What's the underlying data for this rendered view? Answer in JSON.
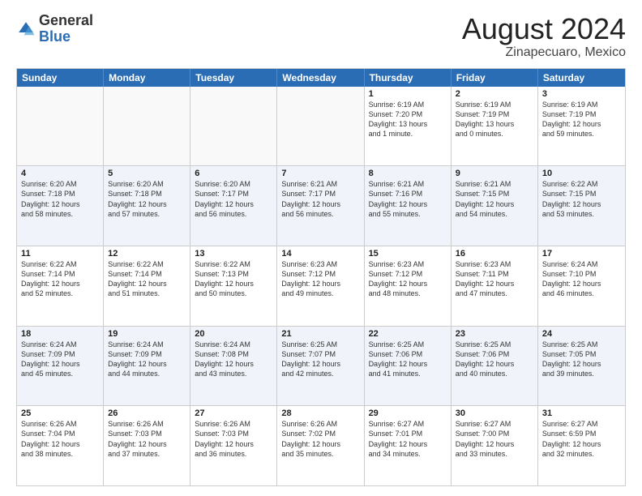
{
  "header": {
    "logo": {
      "general": "General",
      "blue": "Blue"
    },
    "month_year": "August 2024",
    "location": "Zinapecuaro, Mexico"
  },
  "days_of_week": [
    "Sunday",
    "Monday",
    "Tuesday",
    "Wednesday",
    "Thursday",
    "Friday",
    "Saturday"
  ],
  "rows": [
    {
      "alt": false,
      "cells": [
        {
          "day": "",
          "text": ""
        },
        {
          "day": "",
          "text": ""
        },
        {
          "day": "",
          "text": ""
        },
        {
          "day": "",
          "text": ""
        },
        {
          "day": "1",
          "text": "Sunrise: 6:19 AM\nSunset: 7:20 PM\nDaylight: 13 hours\nand 1 minute."
        },
        {
          "day": "2",
          "text": "Sunrise: 6:19 AM\nSunset: 7:19 PM\nDaylight: 13 hours\nand 0 minutes."
        },
        {
          "day": "3",
          "text": "Sunrise: 6:19 AM\nSunset: 7:19 PM\nDaylight: 12 hours\nand 59 minutes."
        }
      ]
    },
    {
      "alt": true,
      "cells": [
        {
          "day": "4",
          "text": "Sunrise: 6:20 AM\nSunset: 7:18 PM\nDaylight: 12 hours\nand 58 minutes."
        },
        {
          "day": "5",
          "text": "Sunrise: 6:20 AM\nSunset: 7:18 PM\nDaylight: 12 hours\nand 57 minutes."
        },
        {
          "day": "6",
          "text": "Sunrise: 6:20 AM\nSunset: 7:17 PM\nDaylight: 12 hours\nand 56 minutes."
        },
        {
          "day": "7",
          "text": "Sunrise: 6:21 AM\nSunset: 7:17 PM\nDaylight: 12 hours\nand 56 minutes."
        },
        {
          "day": "8",
          "text": "Sunrise: 6:21 AM\nSunset: 7:16 PM\nDaylight: 12 hours\nand 55 minutes."
        },
        {
          "day": "9",
          "text": "Sunrise: 6:21 AM\nSunset: 7:15 PM\nDaylight: 12 hours\nand 54 minutes."
        },
        {
          "day": "10",
          "text": "Sunrise: 6:22 AM\nSunset: 7:15 PM\nDaylight: 12 hours\nand 53 minutes."
        }
      ]
    },
    {
      "alt": false,
      "cells": [
        {
          "day": "11",
          "text": "Sunrise: 6:22 AM\nSunset: 7:14 PM\nDaylight: 12 hours\nand 52 minutes."
        },
        {
          "day": "12",
          "text": "Sunrise: 6:22 AM\nSunset: 7:14 PM\nDaylight: 12 hours\nand 51 minutes."
        },
        {
          "day": "13",
          "text": "Sunrise: 6:22 AM\nSunset: 7:13 PM\nDaylight: 12 hours\nand 50 minutes."
        },
        {
          "day": "14",
          "text": "Sunrise: 6:23 AM\nSunset: 7:12 PM\nDaylight: 12 hours\nand 49 minutes."
        },
        {
          "day": "15",
          "text": "Sunrise: 6:23 AM\nSunset: 7:12 PM\nDaylight: 12 hours\nand 48 minutes."
        },
        {
          "day": "16",
          "text": "Sunrise: 6:23 AM\nSunset: 7:11 PM\nDaylight: 12 hours\nand 47 minutes."
        },
        {
          "day": "17",
          "text": "Sunrise: 6:24 AM\nSunset: 7:10 PM\nDaylight: 12 hours\nand 46 minutes."
        }
      ]
    },
    {
      "alt": true,
      "cells": [
        {
          "day": "18",
          "text": "Sunrise: 6:24 AM\nSunset: 7:09 PM\nDaylight: 12 hours\nand 45 minutes."
        },
        {
          "day": "19",
          "text": "Sunrise: 6:24 AM\nSunset: 7:09 PM\nDaylight: 12 hours\nand 44 minutes."
        },
        {
          "day": "20",
          "text": "Sunrise: 6:24 AM\nSunset: 7:08 PM\nDaylight: 12 hours\nand 43 minutes."
        },
        {
          "day": "21",
          "text": "Sunrise: 6:25 AM\nSunset: 7:07 PM\nDaylight: 12 hours\nand 42 minutes."
        },
        {
          "day": "22",
          "text": "Sunrise: 6:25 AM\nSunset: 7:06 PM\nDaylight: 12 hours\nand 41 minutes."
        },
        {
          "day": "23",
          "text": "Sunrise: 6:25 AM\nSunset: 7:06 PM\nDaylight: 12 hours\nand 40 minutes."
        },
        {
          "day": "24",
          "text": "Sunrise: 6:25 AM\nSunset: 7:05 PM\nDaylight: 12 hours\nand 39 minutes."
        }
      ]
    },
    {
      "alt": false,
      "cells": [
        {
          "day": "25",
          "text": "Sunrise: 6:26 AM\nSunset: 7:04 PM\nDaylight: 12 hours\nand 38 minutes."
        },
        {
          "day": "26",
          "text": "Sunrise: 6:26 AM\nSunset: 7:03 PM\nDaylight: 12 hours\nand 37 minutes."
        },
        {
          "day": "27",
          "text": "Sunrise: 6:26 AM\nSunset: 7:03 PM\nDaylight: 12 hours\nand 36 minutes."
        },
        {
          "day": "28",
          "text": "Sunrise: 6:26 AM\nSunset: 7:02 PM\nDaylight: 12 hours\nand 35 minutes."
        },
        {
          "day": "29",
          "text": "Sunrise: 6:27 AM\nSunset: 7:01 PM\nDaylight: 12 hours\nand 34 minutes."
        },
        {
          "day": "30",
          "text": "Sunrise: 6:27 AM\nSunset: 7:00 PM\nDaylight: 12 hours\nand 33 minutes."
        },
        {
          "day": "31",
          "text": "Sunrise: 6:27 AM\nSunset: 6:59 PM\nDaylight: 12 hours\nand 32 minutes."
        }
      ]
    }
  ]
}
